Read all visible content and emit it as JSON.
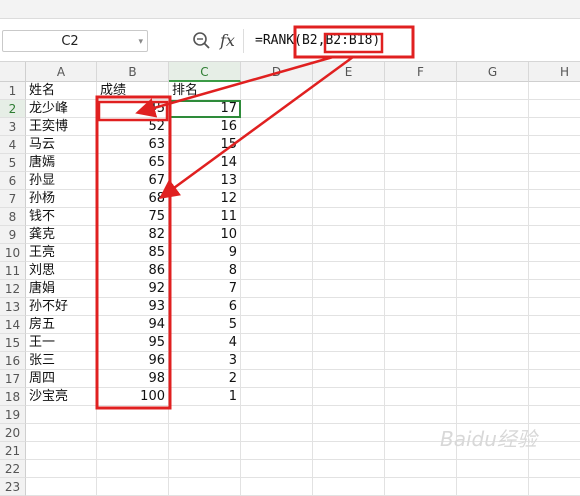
{
  "name_box": "C2",
  "formula": "=RANK(B2,B2:B18)",
  "columns": [
    "A",
    "B",
    "C",
    "D",
    "E",
    "F",
    "G",
    "H"
  ],
  "rows": [
    "1",
    "2",
    "3",
    "4",
    "5",
    "6",
    "7",
    "8",
    "9",
    "10",
    "11",
    "12",
    "13",
    "14",
    "15",
    "16",
    "17",
    "18",
    "19",
    "20",
    "21",
    "22",
    "23"
  ],
  "headers": {
    "name": "姓名",
    "score": "成绩",
    "rank": "排名"
  },
  "data": [
    {
      "name": "龙少峰",
      "score": "45",
      "rank": "17"
    },
    {
      "name": "王奕博",
      "score": "52",
      "rank": "16"
    },
    {
      "name": "马云",
      "score": "63",
      "rank": "15"
    },
    {
      "name": "唐嫣",
      "score": "65",
      "rank": "14"
    },
    {
      "name": "孙显",
      "score": "67",
      "rank": "13"
    },
    {
      "name": "孙杨",
      "score": "68",
      "rank": "12"
    },
    {
      "name": "钱不",
      "score": "75",
      "rank": "11"
    },
    {
      "name": "龚克",
      "score": "82",
      "rank": "10"
    },
    {
      "name": "王亮",
      "score": "85",
      "rank": "9"
    },
    {
      "name": "刘思",
      "score": "86",
      "rank": "8"
    },
    {
      "name": "唐娟",
      "score": "92",
      "rank": "7"
    },
    {
      "name": "孙不好",
      "score": "93",
      "rank": "6"
    },
    {
      "name": "房五",
      "score": "94",
      "rank": "5"
    },
    {
      "name": "王一",
      "score": "95",
      "rank": "4"
    },
    {
      "name": "张三",
      "score": "96",
      "rank": "3"
    },
    {
      "name": "周四",
      "score": "98",
      "rank": "2"
    },
    {
      "name": "沙宝亮",
      "score": "100",
      "rank": "1"
    }
  ],
  "accent_color": "#3c9b47",
  "annotation_color": "#e02020",
  "icons": {
    "zoom": "zoom-icon",
    "fx": "fx-icon",
    "dropdown": "chevron-down-icon"
  },
  "fx_label": "fx",
  "watermark": "Baidu经验"
}
